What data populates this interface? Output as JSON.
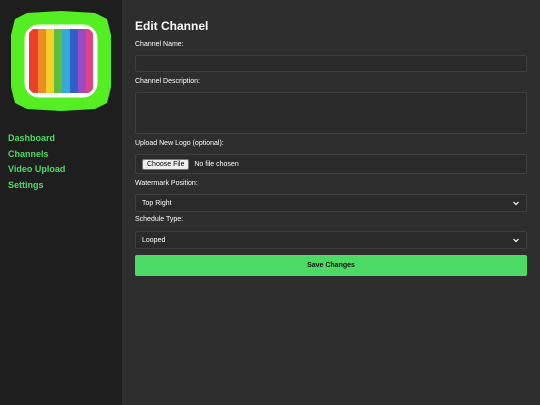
{
  "sidebar": {
    "nav": [
      {
        "label": "Dashboard"
      },
      {
        "label": "Channels"
      },
      {
        "label": "Video Upload"
      },
      {
        "label": "Settings"
      }
    ]
  },
  "form": {
    "title": "Edit Channel",
    "channel_name": {
      "label": "Channel Name:",
      "value": ""
    },
    "channel_description": {
      "label": "Channel Description:",
      "value": ""
    },
    "logo": {
      "label": "Upload New Logo (optional):",
      "button": "Choose File",
      "status": "No file chosen"
    },
    "watermark": {
      "label": "Watermark Position:",
      "value": "Top Right"
    },
    "schedule": {
      "label": "Schedule Type:",
      "value": "Looped"
    },
    "save_label": "Save Changes"
  },
  "colors": {
    "accent": "#4cd964",
    "sidebar_bg": "#1e1e1e",
    "main_bg": "#2e2e2e"
  }
}
